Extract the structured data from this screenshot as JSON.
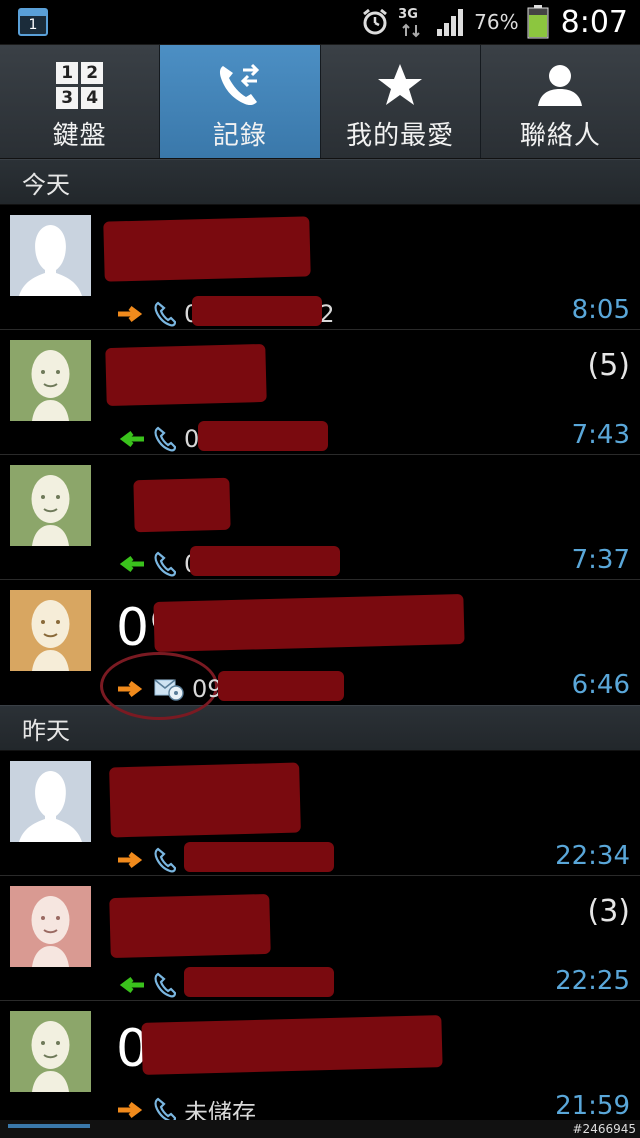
{
  "status_bar": {
    "calendar_day": "1",
    "network": "3G",
    "battery_percent": "76%",
    "battery_level": 0.76,
    "time": "8:07",
    "colors": {
      "battery": "#8cc63f",
      "accent": "#5aa0d8"
    }
  },
  "tabs": [
    {
      "label": "鍵盤",
      "icon": "keypad-icon",
      "keys": [
        "1",
        "2",
        "3",
        "4"
      ],
      "active": false
    },
    {
      "label": "記錄",
      "icon": "call-log-icon",
      "active": true
    },
    {
      "label": "我的最愛",
      "icon": "star-icon",
      "active": false
    },
    {
      "label": "聯絡人",
      "icon": "contact-person-icon",
      "active": false
    }
  ],
  "sections": [
    {
      "title": "今天",
      "entries": [
        {
          "name": "",
          "number_prefix": "0",
          "number_suffix": "2",
          "direction": "outgoing",
          "type": "call",
          "time": "8:05",
          "count": "",
          "avatar": "female-silhouette"
        },
        {
          "name": "",
          "number_prefix": "0",
          "number_suffix": "",
          "direction": "incoming",
          "type": "call",
          "time": "7:43",
          "count": "(5)",
          "avatar": "face-green"
        },
        {
          "name": "",
          "number_prefix": "0",
          "number_suffix": "",
          "direction": "incoming",
          "type": "call",
          "time": "7:37",
          "count": "",
          "avatar": "face-green"
        },
        {
          "name": "09",
          "number_prefix": "09",
          "number_suffix": "",
          "direction": "outgoing",
          "type": "message",
          "time": "6:46",
          "count": "",
          "avatar": "face-orange"
        }
      ]
    },
    {
      "title": "昨天",
      "entries": [
        {
          "name": "",
          "number_prefix": "",
          "number_suffix": "",
          "direction": "outgoing",
          "type": "call",
          "time": "22:34",
          "count": "",
          "avatar": "female-silhouette"
        },
        {
          "name": "",
          "number_prefix": "",
          "number_suffix": "",
          "direction": "incoming",
          "type": "call",
          "time": "22:25",
          "count": "(3)",
          "avatar": "face-pink"
        },
        {
          "name": "0",
          "number_prefix": "未儲存",
          "number_suffix": "",
          "direction": "outgoing",
          "type": "call",
          "time": "21:59",
          "count": "",
          "avatar": "face-green"
        }
      ]
    }
  ],
  "watermark": "#2466945"
}
